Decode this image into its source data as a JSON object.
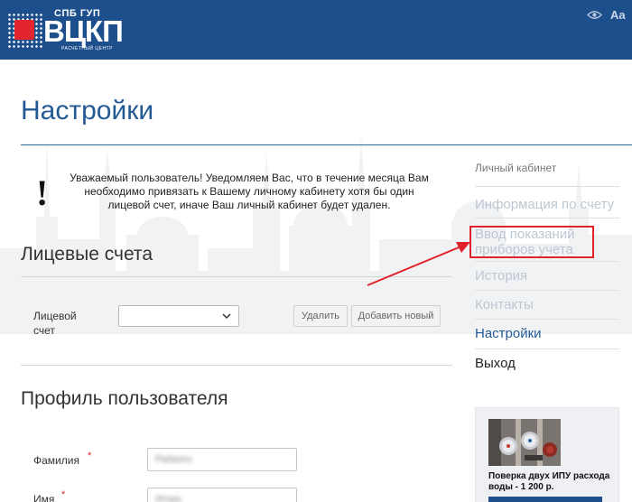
{
  "header": {
    "logo_top": "СПБ ГУП",
    "logo_main": "ВЦКП",
    "logo_sub": "РАСЧЕТНЫЙ ЦЕНТР",
    "font_toggle": "Aa"
  },
  "page": {
    "title": "Настройки"
  },
  "notice": {
    "icon": "!",
    "text": "Уважаемый пользователь! Уведомляем Вас, что в течение месяца Вам необходимо привязать к Вашему личному кабинету хотя бы один лицевой счет, иначе Ваш личный кабинет будет удален."
  },
  "accounts": {
    "title": "Лицевые счета",
    "label": "Лицевой счет",
    "selected": "",
    "delete_label": "Удалить",
    "add_label": "Добавить новый"
  },
  "profile": {
    "title": "Профиль пользователя",
    "lastname_label": "Фамилия",
    "lastname_value": "Рабкого",
    "firstname_label": "Имя",
    "firstname_value": "Игорь",
    "required_mark": "*"
  },
  "sidebar": {
    "header": "Личный кабинет",
    "items": [
      {
        "label": "Информация по счету"
      },
      {
        "label": "Ввод показаний приборов учета"
      },
      {
        "label": "История"
      },
      {
        "label": "Контакты"
      },
      {
        "label": "Настройки"
      },
      {
        "label": "Выход"
      }
    ]
  },
  "promo": {
    "text": "Поверка двух ИПУ расхода воды - 1 200 р."
  },
  "colors": {
    "header_bg": "#1d4f8c",
    "title": "#235a94",
    "highlight": "#e0232b",
    "logo_red": "#e3262d"
  }
}
